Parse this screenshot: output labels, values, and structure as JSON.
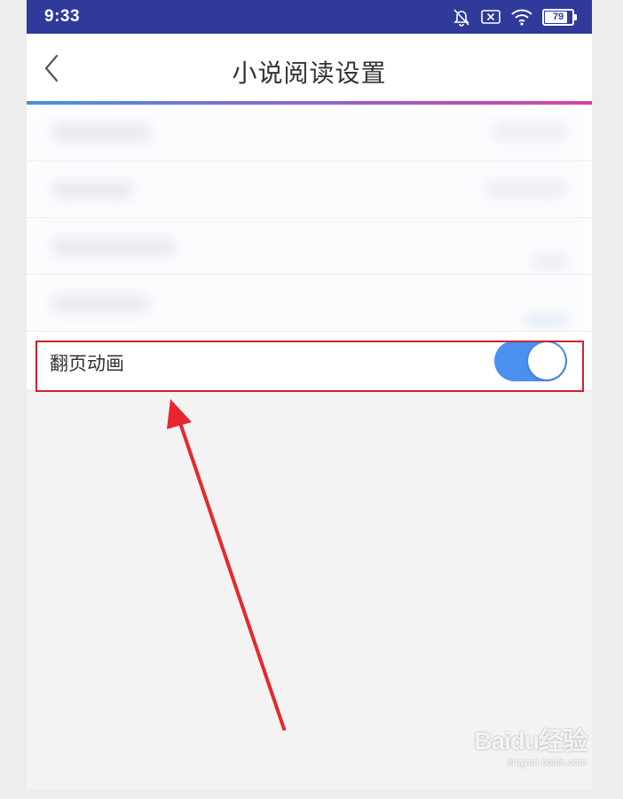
{
  "status_bar": {
    "time": "9:33",
    "battery": "79",
    "icons": [
      "bell-muted-icon",
      "sim-x-icon",
      "wifi-icon",
      "battery-icon"
    ]
  },
  "header": {
    "back_icon": "chevron-left-icon",
    "title": "小说阅读设置"
  },
  "settings": {
    "page_flip_animation": {
      "label": "翻页动画",
      "enabled": true
    }
  },
  "colors": {
    "status_bar": "#2f3a9b",
    "toggle_on": "#4b8ff0",
    "highlight_box": "#d0212b",
    "annotation_arrow": "#e8262f",
    "title_gradient": [
      "#3f8fe0",
      "#8a5cd0",
      "#d9399f"
    ]
  },
  "watermark": {
    "logo": "Baidu经验",
    "url": "jingyan.baidu.com"
  }
}
